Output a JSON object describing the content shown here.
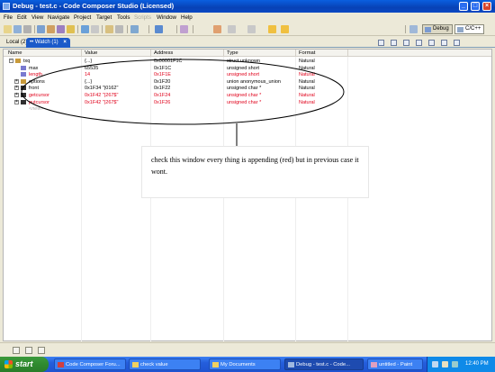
{
  "window": {
    "title": "Debug - test.c - Code Composer Studio (Licensed)"
  },
  "menu": [
    "File",
    "Edit",
    "View",
    "Navigate",
    "Project",
    "Target",
    "Tools",
    "Scripts",
    "Window",
    "Help"
  ],
  "perspectives": {
    "debug": "Debug",
    "cc": "C/C++"
  },
  "tabs": {
    "local": "Local (2)",
    "watch": "Watch (1)",
    "close": "×"
  },
  "columns": {
    "name": "Name",
    "value": "Value",
    "address": "Address",
    "type": "Type",
    "format": "Format"
  },
  "rows": [
    {
      "name": "txq",
      "value": "{...}",
      "address": "0x00001F1C",
      "type": "struct unknown",
      "format": "Natural",
      "red": false,
      "expander": "−"
    },
    {
      "name": "max",
      "value": "65535",
      "address": "0x1F1C",
      "type": "unsigned short",
      "format": "Natural",
      "red": false,
      "expander": ""
    },
    {
      "name": "length",
      "value": "14",
      "address": "0x1F1E",
      "type": "unsigned short",
      "format": "Natural",
      "red": true,
      "expander": ""
    },
    {
      "name": "options",
      "value": "{...}",
      "address": "0x1F20",
      "type": "union anonymous_union",
      "format": "Natural",
      "red": false,
      "expander": "+"
    },
    {
      "name": "front",
      "value": "0x1F34 \"|0162\"",
      "address": "0x1F22",
      "type": "unsigned char *",
      "format": "Natural",
      "red": false,
      "expander": "+"
    },
    {
      "name": "getcursor",
      "value": "0x1F42 \"|267$\"",
      "address": "0x1F24",
      "type": "unsigned char *",
      "format": "Natural",
      "red": true,
      "expander": "+"
    },
    {
      "name": "putcursor",
      "value": "0x1F42 \"|267$\"",
      "address": "0x1F26",
      "type": "unsigned char *",
      "format": "Natural",
      "red": true,
      "expander": "+"
    }
  ],
  "new_expression": "<new>",
  "annotation": "check this window every thing is appending (red) but in previous case it wont.",
  "taskbar": {
    "start": "start",
    "tasks": [
      "Code Composer Foru...",
      "check value",
      "My Documents",
      "Debug - test.c - Code...",
      "untitled - Paint"
    ],
    "clock": "12:40 PM"
  },
  "colors": {
    "changed_value": "#e0001a",
    "title_bar": "#0842b5",
    "active_tab": "#1b5ac9",
    "taskbar": "#245edc",
    "start_button": "#2f8a2f"
  }
}
